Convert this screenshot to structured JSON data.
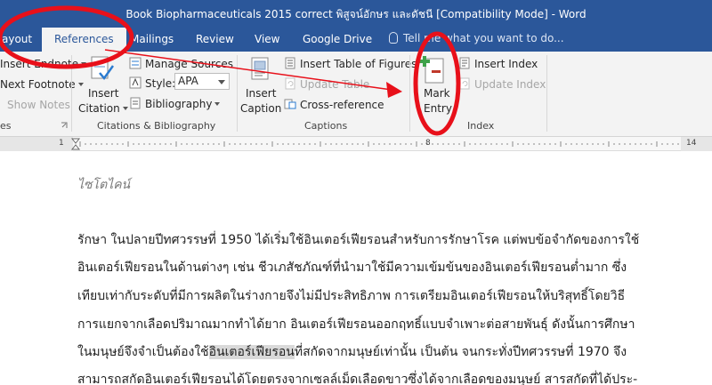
{
  "window": {
    "title": "Book Biopharmaceuticals 2015 correct พิสูจน์อักษร และดัชนี [Compatibility Mode] - Word"
  },
  "tabs": [
    {
      "label": "ayout"
    },
    {
      "label": "References"
    },
    {
      "label": "Mailings"
    },
    {
      "label": "Review"
    },
    {
      "label": "View"
    },
    {
      "label": "Google Drive"
    }
  ],
  "tell_me": "Tell me what you want to do...",
  "ribbon": {
    "footnotes": {
      "insert_endnote": "Insert Endnote",
      "next_footnote": "Next Footnote",
      "show_notes": "Show Notes",
      "group_label": "es"
    },
    "citations": {
      "insert_citation": "Insert",
      "insert_citation_2": "Citation",
      "manage_sources": "Manage Sources",
      "style_label": "Style:",
      "style_value": "APA",
      "bibliography": "Bibliography",
      "group_label": "Citations & Bibliography"
    },
    "captions": {
      "insert_caption": "Insert",
      "insert_caption_2": "Caption",
      "insert_table_of_figures": "Insert Table of Figures",
      "update_table": "Update Table",
      "cross_reference": "Cross-reference",
      "group_label": "Captions"
    },
    "index": {
      "mark_entry": "Mark",
      "mark_entry_2": "Entry",
      "insert_index": "Insert Index",
      "update_index": "Update Index",
      "group_label": "Index"
    }
  },
  "ruler": {
    "left": "1",
    "mid": "8",
    "right": "14"
  },
  "document": {
    "heading": "ไซโตไคน์",
    "lines": [
      "รักษา ในปลายปีทศวรรษที่ 1950 ได้เริ่มใช้อินเตอร์เฟียรอนสำหรับการรักษาโรค แต่พบข้อจำกัดของการใช้",
      "อินเตอร์เฟียรอนในด้านต่างๆ เช่น ชีวเภสัชภัณฑ์ที่นำมาใช้มีความเข้มข้นของอินเตอร์เฟียรอนต่ำมาก ซึ่ง",
      "เทียบเท่ากับระดับที่มีการผลิตในร่างกายจึงไม่มีประสิทธิภาพ การเตรียมอินเตอร์เฟียรอนให้บริสุทธิ์โดยวิธี",
      "การแยกจากเลือดปริมาณมากทำได้ยาก อินเตอร์เฟียรอนออกฤทธิ์แบบจำเพาะต่อสายพันธุ์ ดังนั้นการศึกษา",
      "ในมนุษย์จึงจำเป็นต้องใช้",
      "สามารถสกัดอินเตอร์เฟียรอนได้โดยตรงจากเซลล์เม็ดเลือดขาวซึ่งได้จากเลือดของมนุษย์ สารสกัดที่ได้ประ-"
    ],
    "line5_highlight": "อินเตอร์เฟียรอน",
    "line5_rest": "ที่สกัดจากมนุษย์เท่านั้น เป็นต้น จนกระทั่งปีทศวรรษที่ 1970 จึง"
  },
  "colors": {
    "titlebar": "#2b579a",
    "ribbon": "#f3f3f3",
    "annotation_red": "#e8101a",
    "highlight": "#d9d9d9"
  }
}
